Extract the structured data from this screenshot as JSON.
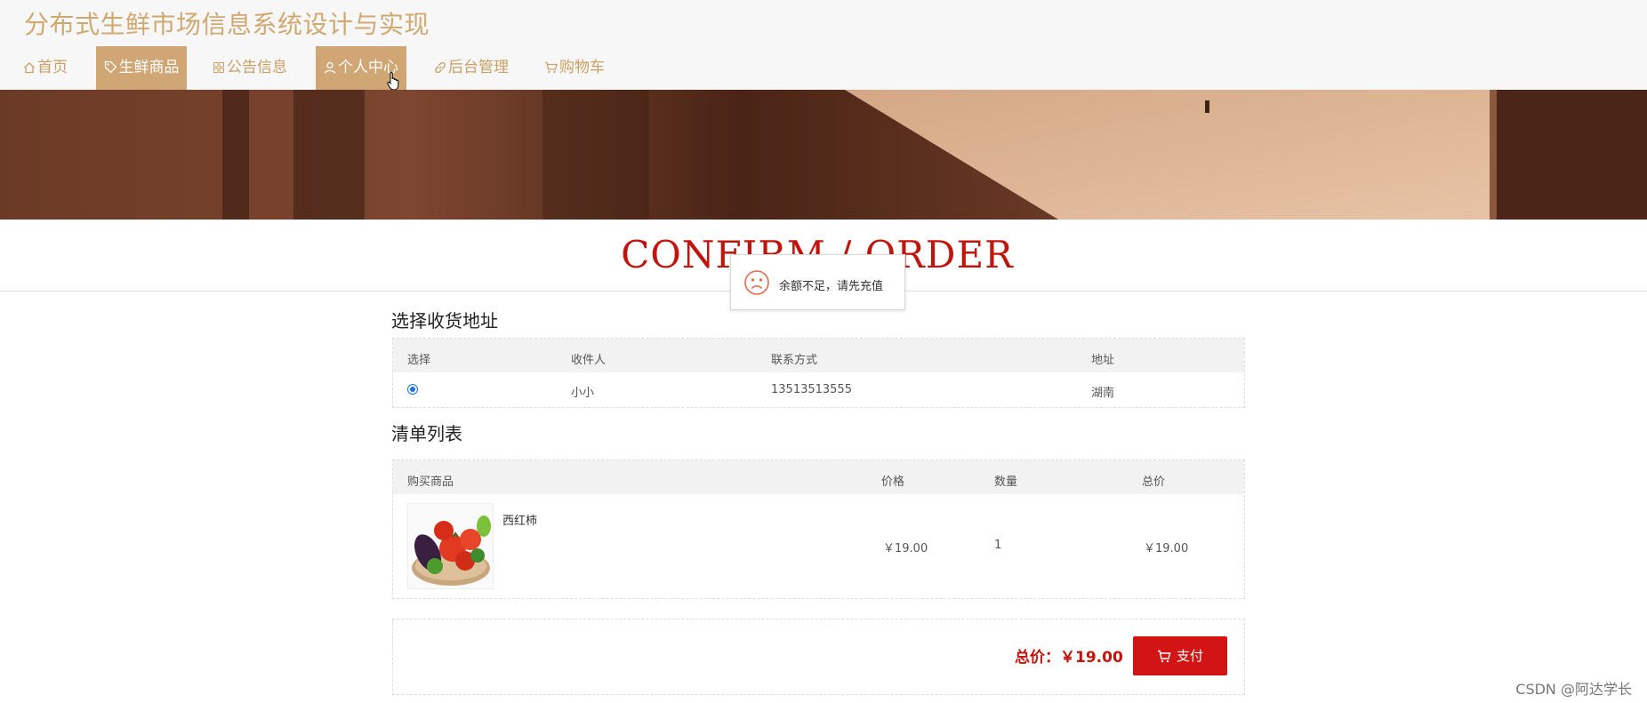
{
  "site": {
    "title": "分布式生鲜市场信息系统设计与实现"
  },
  "nav": {
    "items": [
      {
        "label": "首页",
        "icon": "home-icon",
        "active": false
      },
      {
        "label": "生鲜商品",
        "icon": "tag-icon",
        "active": true
      },
      {
        "label": "公告信息",
        "icon": "apps-icon",
        "active": false
      },
      {
        "label": "个人中心",
        "icon": "user-icon",
        "active": true
      },
      {
        "label": "后台管理",
        "icon": "link-icon",
        "active": false
      },
      {
        "label": "购物车",
        "icon": "cart-icon",
        "active": false
      }
    ]
  },
  "page": {
    "section_title": "CONFIRM / ORDER"
  },
  "toast": {
    "message": "余额不足，请先充值",
    "icon": "sad-face-icon"
  },
  "address": {
    "title": "选择收货地址",
    "headers": [
      "选择",
      "收件人",
      "联系方式",
      "地址"
    ],
    "rows": [
      {
        "selected": true,
        "recipient": "小小",
        "phone": "13513513555",
        "address": "湖南"
      }
    ]
  },
  "order": {
    "title": "清单列表",
    "headers": [
      "购买商品",
      "价格",
      "数量",
      "总价"
    ],
    "items": [
      {
        "name": "西红柿",
        "price": "￥19.00",
        "quantity": "1",
        "total": "￥19.00"
      }
    ]
  },
  "summary": {
    "total_label": "总价：￥19.00",
    "pay_label": "支付"
  },
  "watermark": "CSDN @阿达学长",
  "colors": {
    "accent": "#cfa674",
    "title_red": "#c0140c",
    "pay_red": "#d31414"
  }
}
